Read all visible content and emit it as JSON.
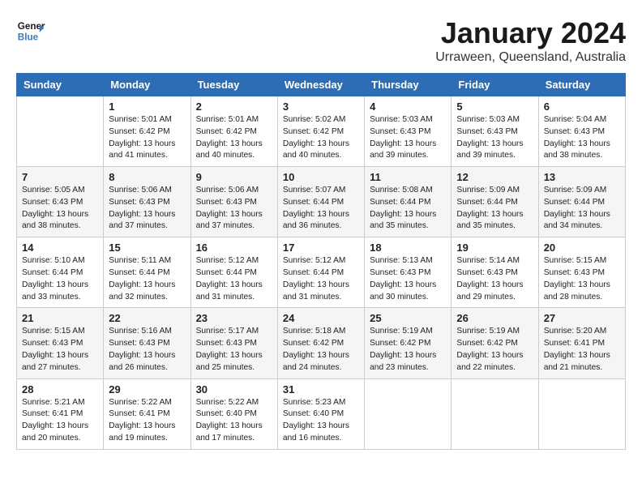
{
  "header": {
    "logo_line1": "General",
    "logo_line2": "Blue",
    "month_title": "January 2024",
    "subtitle": "Urraween, Queensland, Australia"
  },
  "weekdays": [
    "Sunday",
    "Monday",
    "Tuesday",
    "Wednesday",
    "Thursday",
    "Friday",
    "Saturday"
  ],
  "weeks": [
    [
      {
        "day": "",
        "info": ""
      },
      {
        "day": "1",
        "info": "Sunrise: 5:01 AM\nSunset: 6:42 PM\nDaylight: 13 hours\nand 41 minutes."
      },
      {
        "day": "2",
        "info": "Sunrise: 5:01 AM\nSunset: 6:42 PM\nDaylight: 13 hours\nand 40 minutes."
      },
      {
        "day": "3",
        "info": "Sunrise: 5:02 AM\nSunset: 6:42 PM\nDaylight: 13 hours\nand 40 minutes."
      },
      {
        "day": "4",
        "info": "Sunrise: 5:03 AM\nSunset: 6:43 PM\nDaylight: 13 hours\nand 39 minutes."
      },
      {
        "day": "5",
        "info": "Sunrise: 5:03 AM\nSunset: 6:43 PM\nDaylight: 13 hours\nand 39 minutes."
      },
      {
        "day": "6",
        "info": "Sunrise: 5:04 AM\nSunset: 6:43 PM\nDaylight: 13 hours\nand 38 minutes."
      }
    ],
    [
      {
        "day": "7",
        "info": "Sunrise: 5:05 AM\nSunset: 6:43 PM\nDaylight: 13 hours\nand 38 minutes."
      },
      {
        "day": "8",
        "info": "Sunrise: 5:06 AM\nSunset: 6:43 PM\nDaylight: 13 hours\nand 37 minutes."
      },
      {
        "day": "9",
        "info": "Sunrise: 5:06 AM\nSunset: 6:43 PM\nDaylight: 13 hours\nand 37 minutes."
      },
      {
        "day": "10",
        "info": "Sunrise: 5:07 AM\nSunset: 6:44 PM\nDaylight: 13 hours\nand 36 minutes."
      },
      {
        "day": "11",
        "info": "Sunrise: 5:08 AM\nSunset: 6:44 PM\nDaylight: 13 hours\nand 35 minutes."
      },
      {
        "day": "12",
        "info": "Sunrise: 5:09 AM\nSunset: 6:44 PM\nDaylight: 13 hours\nand 35 minutes."
      },
      {
        "day": "13",
        "info": "Sunrise: 5:09 AM\nSunset: 6:44 PM\nDaylight: 13 hours\nand 34 minutes."
      }
    ],
    [
      {
        "day": "14",
        "info": "Sunrise: 5:10 AM\nSunset: 6:44 PM\nDaylight: 13 hours\nand 33 minutes."
      },
      {
        "day": "15",
        "info": "Sunrise: 5:11 AM\nSunset: 6:44 PM\nDaylight: 13 hours\nand 32 minutes."
      },
      {
        "day": "16",
        "info": "Sunrise: 5:12 AM\nSunset: 6:44 PM\nDaylight: 13 hours\nand 31 minutes."
      },
      {
        "day": "17",
        "info": "Sunrise: 5:12 AM\nSunset: 6:44 PM\nDaylight: 13 hours\nand 31 minutes."
      },
      {
        "day": "18",
        "info": "Sunrise: 5:13 AM\nSunset: 6:43 PM\nDaylight: 13 hours\nand 30 minutes."
      },
      {
        "day": "19",
        "info": "Sunrise: 5:14 AM\nSunset: 6:43 PM\nDaylight: 13 hours\nand 29 minutes."
      },
      {
        "day": "20",
        "info": "Sunrise: 5:15 AM\nSunset: 6:43 PM\nDaylight: 13 hours\nand 28 minutes."
      }
    ],
    [
      {
        "day": "21",
        "info": "Sunrise: 5:15 AM\nSunset: 6:43 PM\nDaylight: 13 hours\nand 27 minutes."
      },
      {
        "day": "22",
        "info": "Sunrise: 5:16 AM\nSunset: 6:43 PM\nDaylight: 13 hours\nand 26 minutes."
      },
      {
        "day": "23",
        "info": "Sunrise: 5:17 AM\nSunset: 6:43 PM\nDaylight: 13 hours\nand 25 minutes."
      },
      {
        "day": "24",
        "info": "Sunrise: 5:18 AM\nSunset: 6:42 PM\nDaylight: 13 hours\nand 24 minutes."
      },
      {
        "day": "25",
        "info": "Sunrise: 5:19 AM\nSunset: 6:42 PM\nDaylight: 13 hours\nand 23 minutes."
      },
      {
        "day": "26",
        "info": "Sunrise: 5:19 AM\nSunset: 6:42 PM\nDaylight: 13 hours\nand 22 minutes."
      },
      {
        "day": "27",
        "info": "Sunrise: 5:20 AM\nSunset: 6:41 PM\nDaylight: 13 hours\nand 21 minutes."
      }
    ],
    [
      {
        "day": "28",
        "info": "Sunrise: 5:21 AM\nSunset: 6:41 PM\nDaylight: 13 hours\nand 20 minutes."
      },
      {
        "day": "29",
        "info": "Sunrise: 5:22 AM\nSunset: 6:41 PM\nDaylight: 13 hours\nand 19 minutes."
      },
      {
        "day": "30",
        "info": "Sunrise: 5:22 AM\nSunset: 6:40 PM\nDaylight: 13 hours\nand 17 minutes."
      },
      {
        "day": "31",
        "info": "Sunrise: 5:23 AM\nSunset: 6:40 PM\nDaylight: 13 hours\nand 16 minutes."
      },
      {
        "day": "",
        "info": ""
      },
      {
        "day": "",
        "info": ""
      },
      {
        "day": "",
        "info": ""
      }
    ]
  ]
}
